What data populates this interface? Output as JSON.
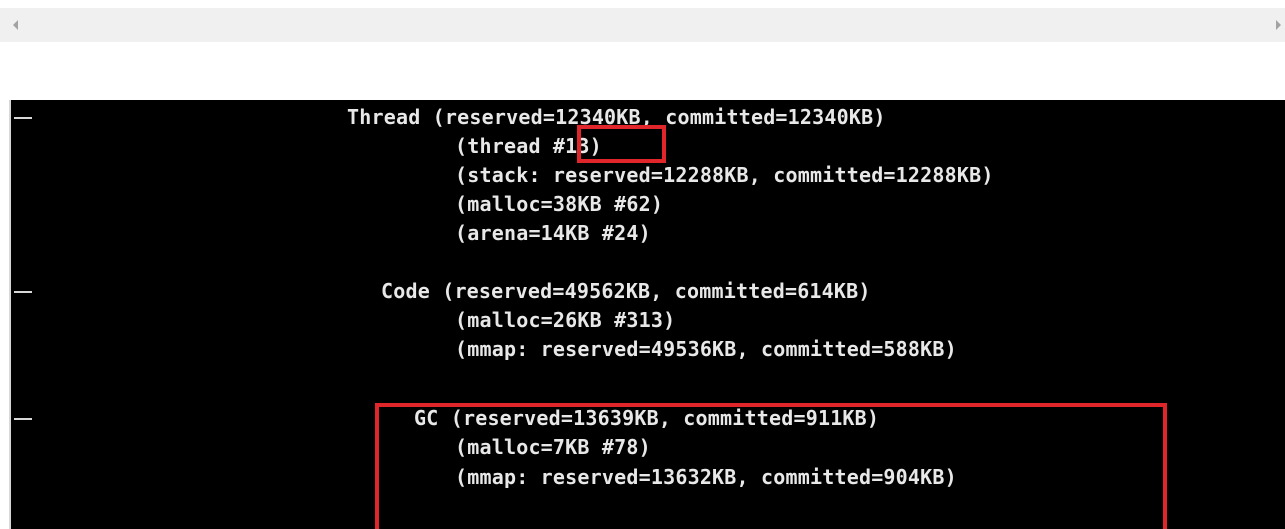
{
  "scrollbar": {
    "left_arrow_icon": "triangle-left-icon",
    "right_arrow_icon": "triangle-right-icon"
  },
  "console": {
    "marker": "-",
    "sections": [
      {
        "name": "Thread",
        "lines": [
          "Thread (reserved=12340KB, committed=12340KB)",
          "(thread #13)",
          "(stack: reserved=12288KB, committed=12288KB)",
          "(malloc=38KB #62)",
          "(arena=14KB #24)"
        ]
      },
      {
        "name": "Code",
        "lines": [
          "Code (reserved=49562KB, committed=614KB)",
          "(malloc=26KB #313)",
          "(mmap: reserved=49536KB, committed=588KB)"
        ]
      },
      {
        "name": "GC",
        "lines": [
          "GC (reserved=13639KB, committed=911KB)",
          "(malloc=7KB #78)",
          "(mmap: reserved=13632KB, committed=904KB)"
        ]
      }
    ]
  },
  "highlight_color": "#e0262a"
}
